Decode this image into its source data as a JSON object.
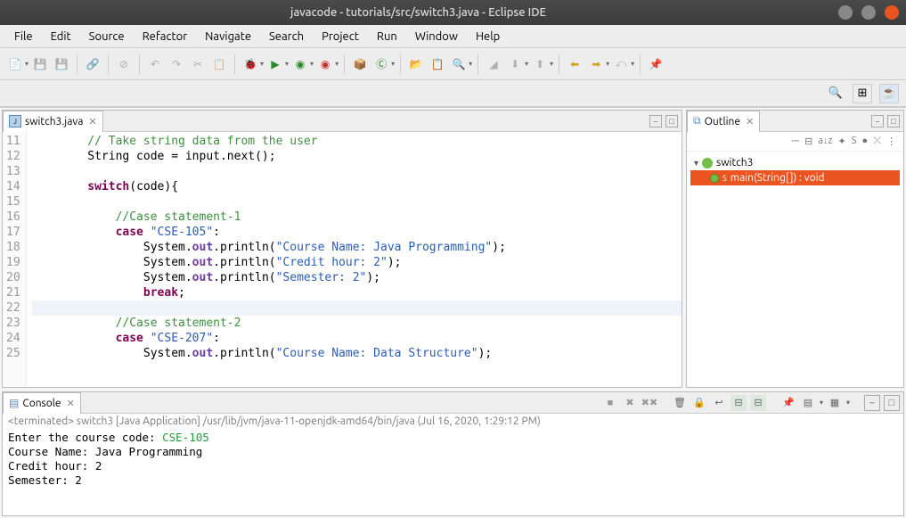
{
  "window": {
    "title": "javacode - tutorials/src/switch3.java - Eclipse IDE"
  },
  "menubar": [
    "File",
    "Edit",
    "Source",
    "Refactor",
    "Navigate",
    "Search",
    "Project",
    "Run",
    "Window",
    "Help"
  ],
  "editor": {
    "tab": {
      "icon_letter": "J",
      "label": "switch3.java",
      "close": "✕"
    },
    "first_line": 11,
    "lines": [
      {
        "n": 11,
        "text": "        // Take string data from the user",
        "kind": "comment"
      },
      {
        "n": 12,
        "text": "        String code = input.next();"
      },
      {
        "n": 13,
        "text": ""
      },
      {
        "n": 14,
        "text": "        switch(code){"
      },
      {
        "n": 15,
        "text": ""
      },
      {
        "n": 16,
        "text": "            //Case statement-1",
        "kind": "comment"
      },
      {
        "n": 17,
        "text": "            case \"CSE-105\":"
      },
      {
        "n": 18,
        "text": "                System.out.println(\"Course Name: Java Programming\");"
      },
      {
        "n": 19,
        "text": "                System.out.println(\"Credit hour: 2\");"
      },
      {
        "n": 20,
        "text": "                System.out.println(\"Semester: 2\");"
      },
      {
        "n": 21,
        "text": "                break;"
      },
      {
        "n": 22,
        "text": "",
        "hl": true
      },
      {
        "n": 23,
        "text": "            //Case statement-2",
        "kind": "comment"
      },
      {
        "n": 24,
        "text": "            case \"CSE-207\":"
      },
      {
        "n": 25,
        "text": "                System.out.println(\"Course Name: Data Structure\");"
      }
    ]
  },
  "outline": {
    "title": "Outline",
    "class": "switch3",
    "method": "main(String[]) : void"
  },
  "console": {
    "title": "Console",
    "status_prefix": "<terminated>",
    "status": "switch3 [Java Application] /usr/lib/jvm/java-11-openjdk-amd64/bin/java (Jul 16, 2020, 1:29:12 PM)",
    "lines": [
      {
        "t": "Enter the course code: ",
        "input": "CSE-105"
      },
      {
        "t": "Course Name: Java Programming"
      },
      {
        "t": "Credit hour: 2"
      },
      {
        "t": "Semester: 2"
      }
    ]
  }
}
